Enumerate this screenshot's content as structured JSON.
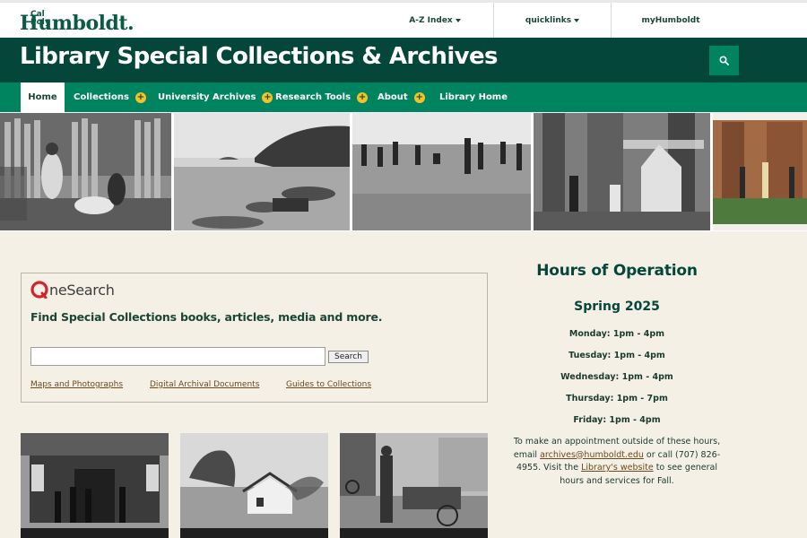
{
  "header": {
    "logo_small": "Cal Poly",
    "logo_main": "Humboldt.",
    "utility_links": [
      {
        "label": "A-Z Index",
        "has_dropdown": true
      },
      {
        "label": "quicklinks",
        "has_dropdown": true
      },
      {
        "label": "myHumboldt",
        "has_dropdown": false
      }
    ]
  },
  "title_band": {
    "title": "Library Special Collections & Archives",
    "search_icon": "search-icon"
  },
  "nav": {
    "items": [
      {
        "label": "Home",
        "active": true,
        "expandable": false
      },
      {
        "label": "Collections",
        "active": false,
        "expandable": true
      },
      {
        "label": "University Archives",
        "active": false,
        "expandable": true
      },
      {
        "label": "Research Tools",
        "active": false,
        "expandable": true
      },
      {
        "label": "About",
        "active": false,
        "expandable": true
      },
      {
        "label": "Library Home",
        "active": false,
        "expandable": false
      }
    ],
    "expand_symbol": "+"
  },
  "onesearch": {
    "logo_letter": "O",
    "logo_text": "neSearch",
    "heading": "Find Special Collections books, articles, media and more.",
    "input_value": "",
    "button_label": "Search",
    "links": [
      "Maps and Photographs",
      "Digital Archival Documents",
      "Guides to Collections"
    ]
  },
  "hours": {
    "title": "Hours of Operation",
    "term": "Spring 2025",
    "days": [
      "Monday: 1pm - 4pm",
      "Tuesday: 1pm - 4pm",
      "Wednesday: 1pm - 4pm",
      "Thursday: 1pm - 7pm",
      "Friday: 1pm - 4pm"
    ],
    "note_pre": "To make an appointment outside of these hours, email ",
    "note_email": "archives@humboldt.edu",
    "note_mid": " or call (707) 826-4955. Visit the ",
    "note_link": "Library's website",
    "note_post": " to see general hours and services for Fall."
  },
  "colors": {
    "brand_dark": "#05463a",
    "brand_green": "#00835f",
    "accent_gold": "#f5c226",
    "page_bg": "#f4f0e6",
    "link_brown": "#6b4a1e"
  }
}
